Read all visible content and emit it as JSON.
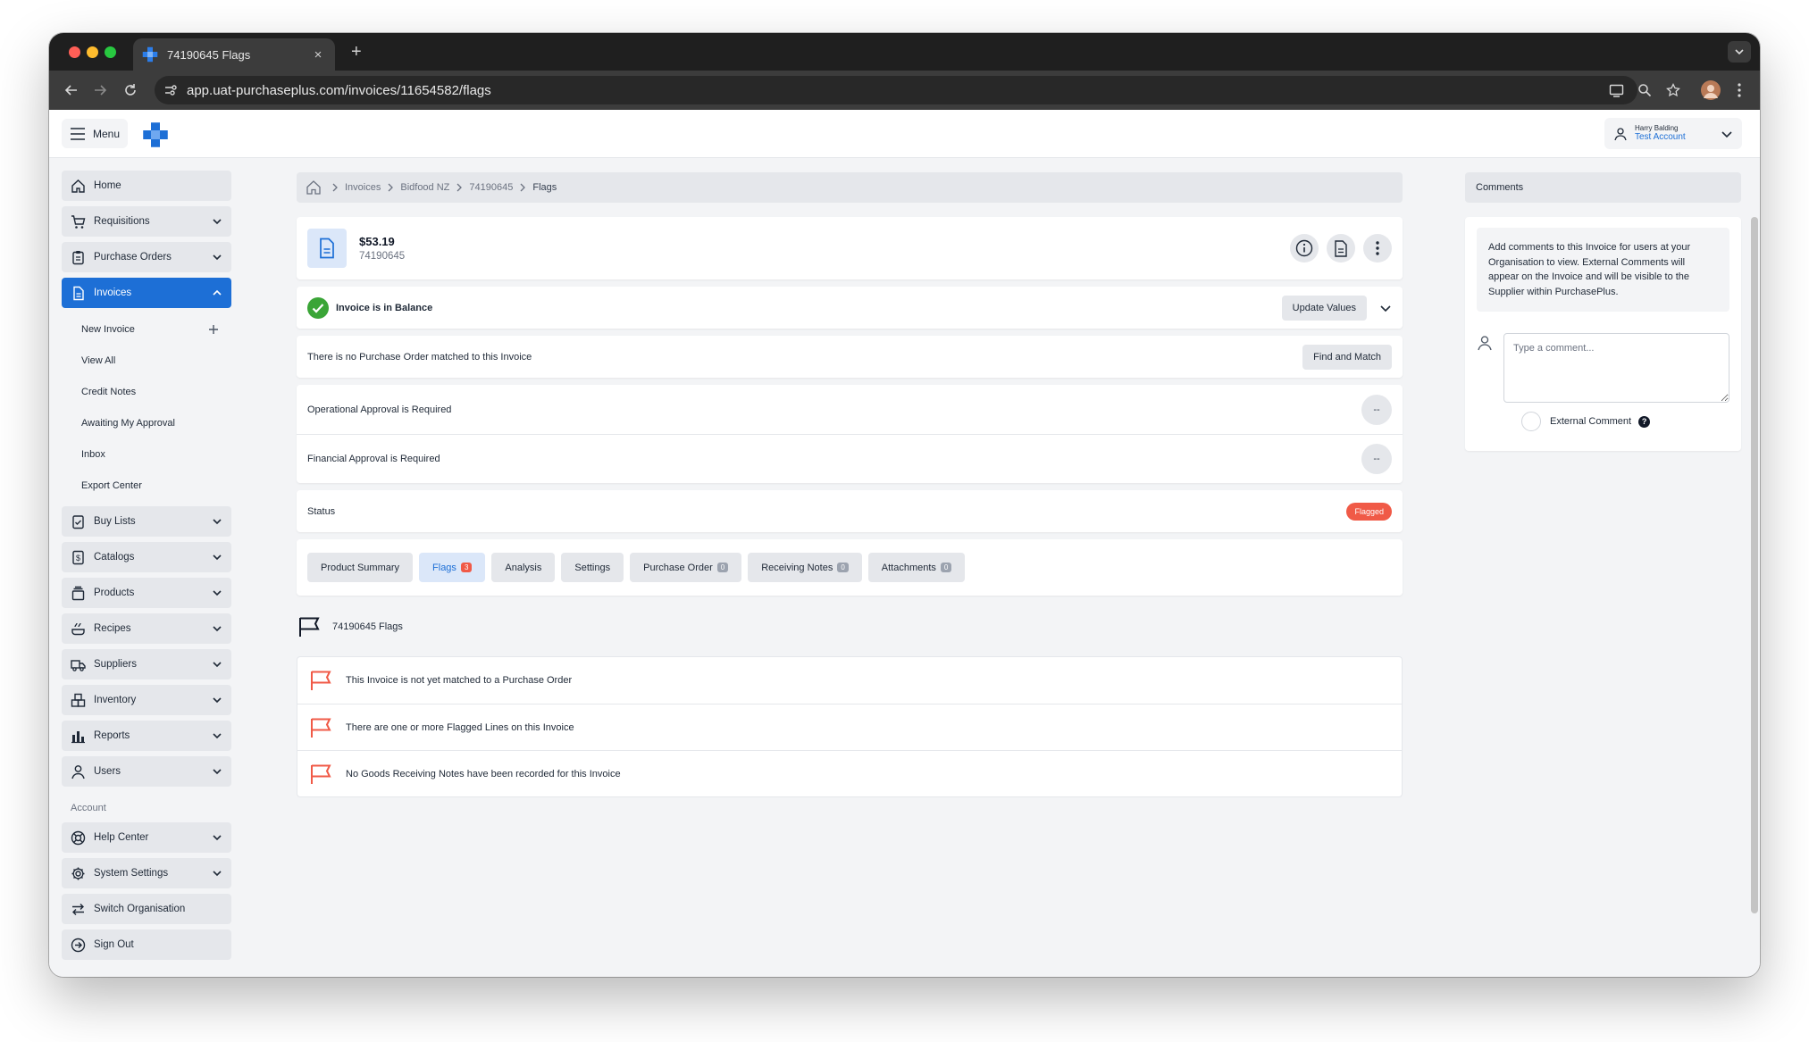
{
  "browser": {
    "tab_title": "74190645 Flags",
    "tab_close": "×",
    "new_tab": "+",
    "url": "app.uat-purchaseplus.com/invoices/11654582/flags"
  },
  "topbar": {
    "menu_label": "Menu",
    "user_name": "Harry Balding",
    "user_account": "Test Account"
  },
  "sidebar": {
    "items": [
      {
        "label": "Home",
        "icon": "home-icon",
        "chevron": false
      },
      {
        "label": "Requisitions",
        "icon": "cart-icon",
        "chevron": true
      },
      {
        "label": "Purchase Orders",
        "icon": "clipboard-icon",
        "chevron": true
      },
      {
        "label": "Invoices",
        "icon": "invoice-icon",
        "chevron": true,
        "active": true
      }
    ],
    "invoice_subitems": [
      "New Invoice",
      "View All",
      "Credit Notes",
      "Awaiting My Approval",
      "Inbox",
      "Export Center"
    ],
    "items_after": [
      {
        "label": "Buy Lists",
        "icon": "buylist-icon"
      },
      {
        "label": "Catalogs",
        "icon": "catalog-icon"
      },
      {
        "label": "Products",
        "icon": "products-icon"
      },
      {
        "label": "Recipes",
        "icon": "recipes-icon"
      },
      {
        "label": "Suppliers",
        "icon": "truck-icon"
      },
      {
        "label": "Inventory",
        "icon": "inventory-icon"
      },
      {
        "label": "Reports",
        "icon": "reports-icon"
      },
      {
        "label": "Users",
        "icon": "users-icon"
      }
    ],
    "account_label": "Account",
    "account_items": [
      {
        "label": "Help Center",
        "icon": "lifebuoy-icon",
        "chevron": true
      },
      {
        "label": "System Settings",
        "icon": "gear-icon",
        "chevron": true
      },
      {
        "label": "Switch Organisation",
        "icon": "switch-icon",
        "chevron": false
      },
      {
        "label": "Sign Out",
        "icon": "signout-icon",
        "chevron": false
      }
    ]
  },
  "breadcrumb": [
    "Invoices",
    "Bidfood NZ",
    "74190645",
    "Flags"
  ],
  "invoice": {
    "amount": "$53.19",
    "number": "74190645"
  },
  "balance": {
    "text": "Invoice is in Balance",
    "button": "Update Values"
  },
  "po_match": {
    "text": "There is no Purchase Order matched to this Invoice",
    "button": "Find and Match"
  },
  "approvals": [
    {
      "text": "Operational Approval is Required",
      "value": "--"
    },
    {
      "text": "Financial Approval is Required",
      "value": "--"
    }
  ],
  "status": {
    "label": "Status",
    "value": "Flagged"
  },
  "tabs": [
    {
      "label": "Product Summary"
    },
    {
      "label": "Flags",
      "count": "3",
      "active": true
    },
    {
      "label": "Analysis"
    },
    {
      "label": "Settings"
    },
    {
      "label": "Purchase Order",
      "count": "0"
    },
    {
      "label": "Receiving Notes",
      "count": "0"
    },
    {
      "label": "Attachments",
      "count": "0"
    }
  ],
  "flags": {
    "title": "74190645 Flags",
    "items": [
      "This Invoice is not yet matched to a Purchase Order",
      "There are one or more Flagged Lines on this Invoice",
      "No Goods Receiving Notes have been recorded for this Invoice"
    ]
  },
  "comments": {
    "title": "Comments",
    "info": "Add comments to this Invoice for users at your Organisation to view. External Comments will appear on the Invoice and will be visible to the Supplier within PurchasePlus.",
    "placeholder": "Type a comment...",
    "external_label": "External Comment",
    "help_glyph": "?"
  },
  "colors": {
    "accent": "#1d6fd6",
    "flag_red": "#f05a47",
    "success_green": "#3aa537"
  }
}
